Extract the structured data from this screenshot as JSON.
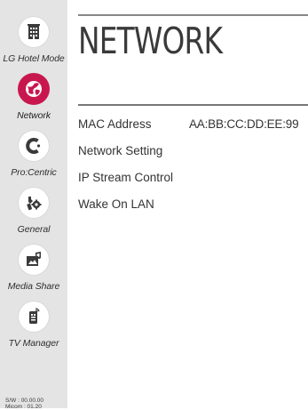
{
  "sidebar": {
    "items": [
      {
        "label": "LG Hotel Mode",
        "icon": "hotel-building-icon",
        "active": false
      },
      {
        "label": "Network",
        "icon": "network-globe-icon",
        "active": true
      },
      {
        "label": "Pro:Centric",
        "icon": "procentric-icon",
        "active": false
      },
      {
        "label": "General",
        "icon": "general-tools-icon",
        "active": false
      },
      {
        "label": "Media Share",
        "icon": "media-share-icon",
        "active": false
      },
      {
        "label": "TV Manager",
        "icon": "tv-manager-icon",
        "active": false
      }
    ],
    "version_sw": "S/W : 00.00.00",
    "version_micom": "Micom : 01.20"
  },
  "main": {
    "title": "NETWORK",
    "menu": [
      {
        "label": "MAC Address",
        "value": "AA:BB:CC:DD:EE:99"
      },
      {
        "label": "Network Setting",
        "value": ""
      },
      {
        "label": "IP Stream Control",
        "value": ""
      },
      {
        "label": "Wake On LAN",
        "value": ""
      }
    ]
  },
  "colors": {
    "accent": "#c8174f",
    "sidebar_bg": "#e4e4e4",
    "text": "#333333"
  }
}
